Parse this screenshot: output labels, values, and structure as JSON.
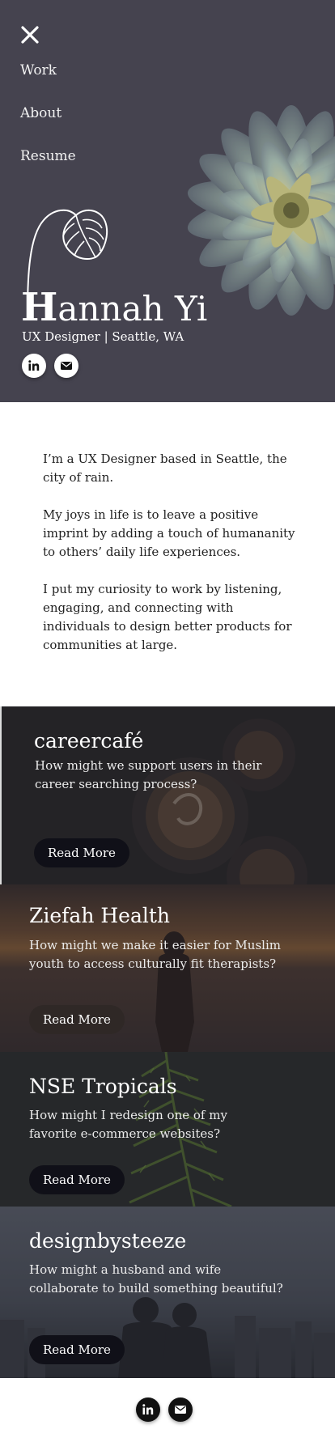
{
  "nav": {
    "close_icon": "close-icon",
    "items": [
      {
        "label": "Work"
      },
      {
        "label": "About"
      },
      {
        "label": "Resume"
      }
    ]
  },
  "hero": {
    "name_initial": "H",
    "name_rest": "annah Yi",
    "subtitle": "UX Designer | Seattle, WA",
    "social": [
      {
        "icon": "linkedin-icon"
      },
      {
        "icon": "mail-icon"
      }
    ]
  },
  "intro": {
    "paragraphs": [
      "I’m a UX Designer based in Seattle, the city of rain.",
      "My joys in life is to leave a positive imprint by adding a touch of humananity to others’ daily life experiences.",
      "I put my curiosity to work by listening, engaging, and connecting with individuals to design better products for communities at large."
    ]
  },
  "projects": [
    {
      "title": "careercafé",
      "description": "How might we support users in their career searching process?",
      "button": "Read More"
    },
    {
      "title": "Ziefah Health",
      "description": "How might we make it easier for Muslim youth to access culturally fit therapists?",
      "button": "Read More"
    },
    {
      "title": "NSE Tropicals",
      "description": "How might I redesign one of my favorite e-commerce websites?",
      "button": "Read More"
    },
    {
      "title": "designbysteeze",
      "description": "How might a husband and wife collaborate to build something beautiful?",
      "button": "Read More"
    }
  ],
  "footer": {
    "social": [
      {
        "icon": "linkedin-icon"
      },
      {
        "icon": "mail-icon"
      }
    ]
  },
  "colors": {
    "hero_bg": "#45434f",
    "button_bg": "#101018",
    "text_dark": "#1f1f1f"
  }
}
